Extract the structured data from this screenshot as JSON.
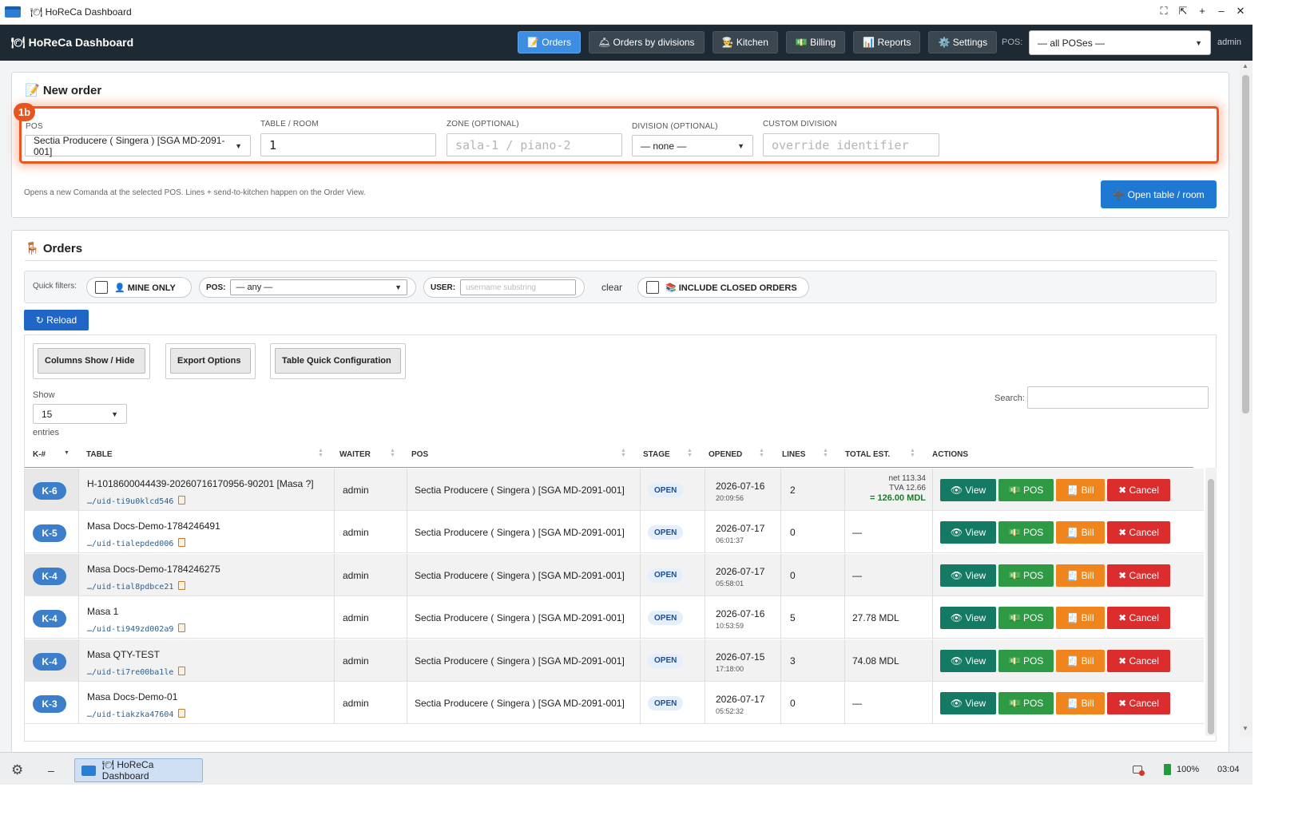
{
  "window": {
    "title": "HoReCa Dashboard",
    "icon": "folder-icon",
    "controls": [
      "⛶",
      "⇱",
      "+",
      "–",
      "✕"
    ]
  },
  "nav": {
    "brand": "🍽 HoReCa Dashboard",
    "buttons": [
      {
        "label": "📝 Orders",
        "active": true
      },
      {
        "label": "🛎 Orders by divisions"
      },
      {
        "label": "👨‍🍳 Kitchen"
      },
      {
        "label": "💵 Billing"
      },
      {
        "label": "📊 Reports"
      },
      {
        "label": "⚙️ Settings"
      }
    ],
    "pos_label": "POS:",
    "pos_value": "— all POSes —",
    "user": "admin"
  },
  "new_order": {
    "title": "📝 New order",
    "badge": "1b",
    "pos_label": "POS",
    "pos_value": "Sectia Producere ( Singera ) [SGA MD-2091-001]",
    "table_label": "TABLE / ROOM",
    "table_value": "1",
    "zone_label": "ZONE (OPTIONAL)",
    "zone_placeholder": "sala-1 / piano-2",
    "division_label": "DIVISION (OPTIONAL)",
    "division_value": "— none —",
    "custom_label": "CUSTOM DIVISION",
    "custom_placeholder": "override identifier",
    "hint": "Opens a new Comanda at the selected POS. Lines + send-to-kitchen happen on the Order View.",
    "open_button": "➕ Open table / room"
  },
  "orders": {
    "title": "🪑 Orders",
    "quick_filters_label": "Quick filters:",
    "mine_only": "👤 MINE ONLY",
    "pos_filter_label": "POS:",
    "pos_filter_value": "— any —",
    "user_filter_label": "USER:",
    "user_filter_placeholder": "username substring",
    "clear": "clear",
    "include_closed": "📚 INCLUDE CLOSED ORDERS",
    "reload": "↻ Reload",
    "dt_buttons": [
      "Columns Show / Hide",
      "Export Options",
      "Table Quick Configuration"
    ],
    "show_label": "Show",
    "show_value": "15",
    "entries_label": "entries",
    "search_label": "Search:",
    "columns": [
      "K-#",
      "TABLE",
      "WAITER",
      "POS",
      "STAGE",
      "OPENED",
      "LINES",
      "TOTAL EST.",
      "ACTIONS"
    ],
    "actions": {
      "view": "👁 View",
      "pos": "💵 POS",
      "bill": "🧾 Bill",
      "cancel": "✖ Cancel"
    },
    "rows": [
      {
        "k": "K-6",
        "table": "H-1018600044439-20260716170956-90201 [Masa ?]",
        "uid": "…/uid-ti9u0klcd546",
        "waiter": "admin",
        "pos": "Sectia Producere ( Singera ) [SGA MD-2091-001]",
        "stage": "OPEN",
        "date": "2026-07-16",
        "time": "20:09:56",
        "lines": "2",
        "total": "",
        "net": "net 113.34",
        "tva": "TVA 12.66",
        "gross": "= 126.00 MDL"
      },
      {
        "k": "K-5",
        "table": "Masa Docs-Demo-1784246491",
        "uid": "…/uid-tialepded006",
        "waiter": "admin",
        "pos": "Sectia Producere ( Singera ) [SGA MD-2091-001]",
        "stage": "OPEN",
        "date": "2026-07-17",
        "time": "06:01:37",
        "lines": "0",
        "total": "—"
      },
      {
        "k": "K-4",
        "table": "Masa Docs-Demo-1784246275",
        "uid": "…/uid-tial8pdbce21",
        "waiter": "admin",
        "pos": "Sectia Producere ( Singera ) [SGA MD-2091-001]",
        "stage": "OPEN",
        "date": "2026-07-17",
        "time": "05:58:01",
        "lines": "0",
        "total": "—"
      },
      {
        "k": "K-4",
        "table": "Masa 1",
        "uid": "…/uid-ti949zd002a9",
        "waiter": "admin",
        "pos": "Sectia Producere ( Singera ) [SGA MD-2091-001]",
        "stage": "OPEN",
        "date": "2026-07-16",
        "time": "10:53:59",
        "lines": "5",
        "total": "27.78 MDL"
      },
      {
        "k": "K-4",
        "table": "Masa QTY-TEST",
        "uid": "…/uid-ti7re00ba1le",
        "waiter": "admin",
        "pos": "Sectia Producere ( Singera ) [SGA MD-2091-001]",
        "stage": "OPEN",
        "date": "2026-07-15",
        "time": "17:18:00",
        "lines": "3",
        "total": "74.08 MDL"
      },
      {
        "k": "K-3",
        "table": "Masa Docs-Demo-01",
        "uid": "…/uid-tiakzka47604",
        "waiter": "admin",
        "pos": "Sectia Producere ( Singera ) [SGA MD-2091-001]",
        "stage": "OPEN",
        "date": "2026-07-17",
        "time": "05:52:32",
        "lines": "0",
        "total": "—"
      }
    ]
  },
  "taskbar": {
    "app": "🍽 HoReCa Dashboard",
    "battery": "100%",
    "clock": "03:04"
  }
}
